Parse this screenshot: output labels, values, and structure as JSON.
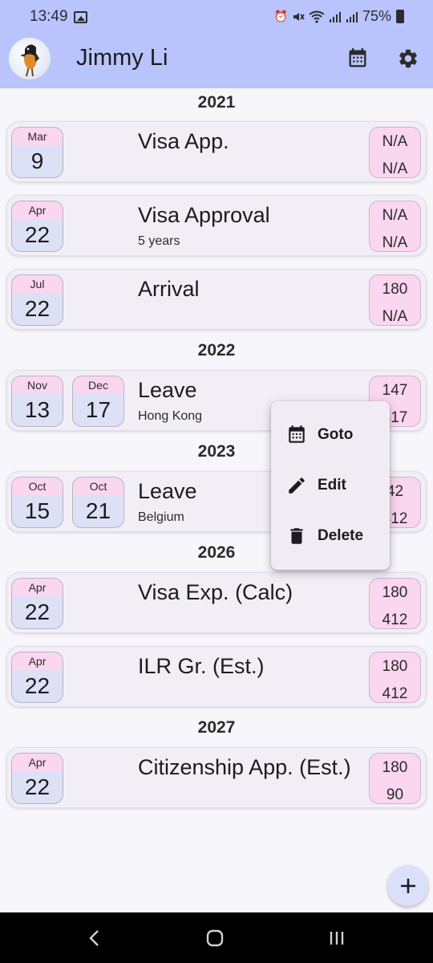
{
  "status_bar": {
    "time": "13:49",
    "battery": "75%",
    "icons": [
      "image-icon",
      "alarm-icon",
      "mute-icon",
      "wifi-icon",
      "signal-icon",
      "signal-icon",
      "battery-icon"
    ]
  },
  "app_bar": {
    "title": "Jimmy Li",
    "actions": [
      "calendar-icon",
      "settings-icon"
    ]
  },
  "years": [
    "2021",
    "2022",
    "2023",
    "2026",
    "2027"
  ],
  "events": [
    {
      "dates": [
        {
          "month": "Mar",
          "day": "9"
        }
      ],
      "title": "Visa App.",
      "subtitle": "",
      "count_top": "N/A",
      "count_bottom": "N/A"
    },
    {
      "dates": [
        {
          "month": "Apr",
          "day": "22"
        }
      ],
      "title": "Visa Approval",
      "subtitle": "5 years",
      "count_top": "N/A",
      "count_bottom": "N/A"
    },
    {
      "dates": [
        {
          "month": "Jul",
          "day": "22"
        }
      ],
      "title": "Arrival",
      "subtitle": "",
      "count_top": "180",
      "count_bottom": "N/A"
    },
    {
      "dates": [
        {
          "month": "Nov",
          "day": "13"
        },
        {
          "month": "Dec",
          "day": "17"
        }
      ],
      "title": "Leave",
      "subtitle": "Hong Kong",
      "count_top": "147",
      "count_bottom": "417"
    },
    {
      "dates": [
        {
          "month": "Oct",
          "day": "15"
        },
        {
          "month": "Oct",
          "day": "21"
        }
      ],
      "title": "Leave",
      "subtitle": "Belgium",
      "count_top": "42",
      "count_bottom": "412"
    },
    {
      "dates": [
        {
          "month": "Apr",
          "day": "22"
        }
      ],
      "title": "Visa Exp. (Calc)",
      "subtitle": "",
      "count_top": "180",
      "count_bottom": "412"
    },
    {
      "dates": [
        {
          "month": "Apr",
          "day": "22"
        }
      ],
      "title": "ILR Gr. (Est.)",
      "subtitle": "",
      "count_top": "180",
      "count_bottom": "412"
    },
    {
      "dates": [
        {
          "month": "Apr",
          "day": "22"
        }
      ],
      "title": "Citizenship App. (Est.)",
      "subtitle": "",
      "count_top": "180",
      "count_bottom": "90"
    }
  ],
  "context_menu": {
    "items": [
      {
        "label": "Goto",
        "icon": "calendar-icon"
      },
      {
        "label": "Edit",
        "icon": "pencil-icon"
      },
      {
        "label": "Delete",
        "icon": "trash-icon"
      }
    ]
  },
  "fab": {
    "icon": "plus-icon"
  },
  "nav": {
    "icons": [
      "back-icon",
      "home-icon",
      "recents-icon"
    ]
  },
  "colors": {
    "app_bar": "#b8c4fb",
    "chip_month": "#fad6ef",
    "chip_day": "#dde1f6",
    "count_chip": "#fad6ef",
    "card": "#f2eef6"
  }
}
